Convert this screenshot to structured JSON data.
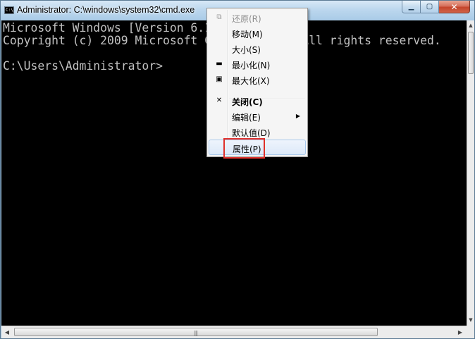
{
  "window": {
    "title": "Administrator: C:\\windows\\system32\\cmd.exe",
    "app_icon_text": "C:\\",
    "min_glyph": "▁",
    "max_glyph": "▢",
    "close_glyph": "✕"
  },
  "console": {
    "lines": [
      "Microsoft Windows [Version 6.1.7601]",
      "Copyright (c) 2009 Microsoft Corporation.  All rights reserved.",
      "",
      "C:\\Users\\Administrator>"
    ]
  },
  "system_menu": {
    "items": [
      {
        "label": "还原(R)",
        "icon": "restore-icon",
        "glyph": "⧉",
        "disabled": true
      },
      {
        "label": "移动(M)"
      },
      {
        "label": "大小(S)"
      },
      {
        "label": "最小化(N)",
        "icon": "minimize-icon",
        "glyph": "▬"
      },
      {
        "label": "最大化(X)",
        "icon": "maximize-icon",
        "glyph": "▣"
      },
      {
        "label": "关闭(C)",
        "icon": "close-icon",
        "glyph": "✕",
        "bold": true
      },
      {
        "label": "编辑(E)",
        "submenu": true,
        "arrow": "▶"
      },
      {
        "label": "默认值(D)"
      },
      {
        "label": "属性(P)",
        "hover": true
      }
    ]
  },
  "scrollbars": {
    "up_arrow": "▲",
    "down_arrow": "▼",
    "left_arrow": "◀",
    "right_arrow": "▶",
    "grip": "|||"
  },
  "colors": {
    "annotation_box": "#e0302b",
    "console_bg": "#000000",
    "console_text": "#c0c0c0"
  }
}
